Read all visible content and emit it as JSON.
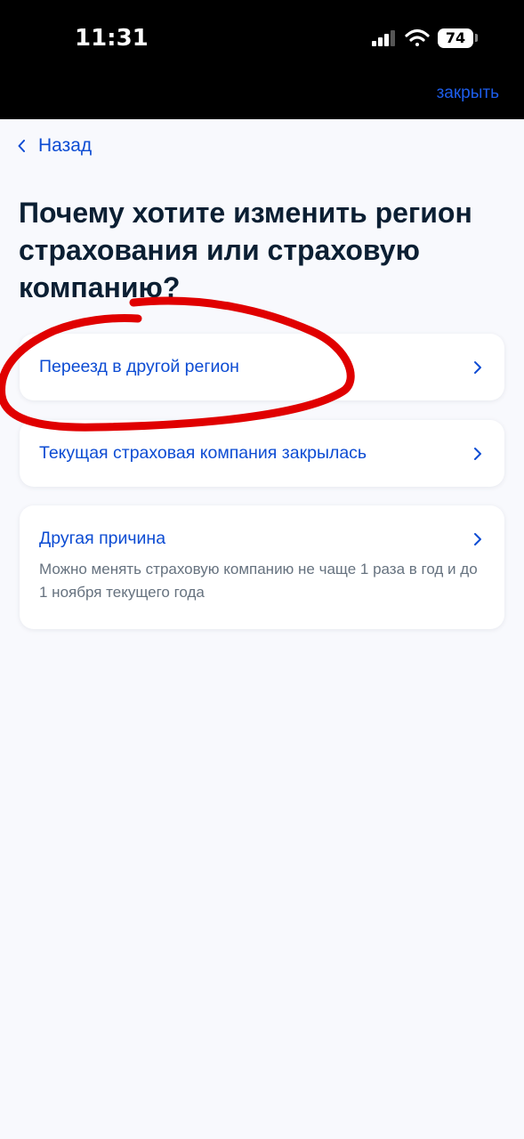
{
  "status_bar": {
    "time": "11:31",
    "battery": "74"
  },
  "header": {
    "close_label": "закрыть"
  },
  "nav": {
    "back_label": "Назад"
  },
  "main": {
    "title": "Почему хотите изменить регион страхования или страховую компанию?",
    "options": [
      {
        "label": "Переезд в другой регион"
      },
      {
        "label": "Текущая страховая компания закрылась"
      },
      {
        "label": "Другая причина",
        "description": "Можно менять страховую компанию не чаще 1 раза в год и до 1 ноября текущего года"
      }
    ]
  },
  "colors": {
    "accent": "#0d4cd3",
    "title_text": "#0b1f33",
    "annotation_stroke": "#e00000"
  },
  "icons": {
    "back": "chevron-left-icon",
    "option": "chevron-right-icon"
  }
}
